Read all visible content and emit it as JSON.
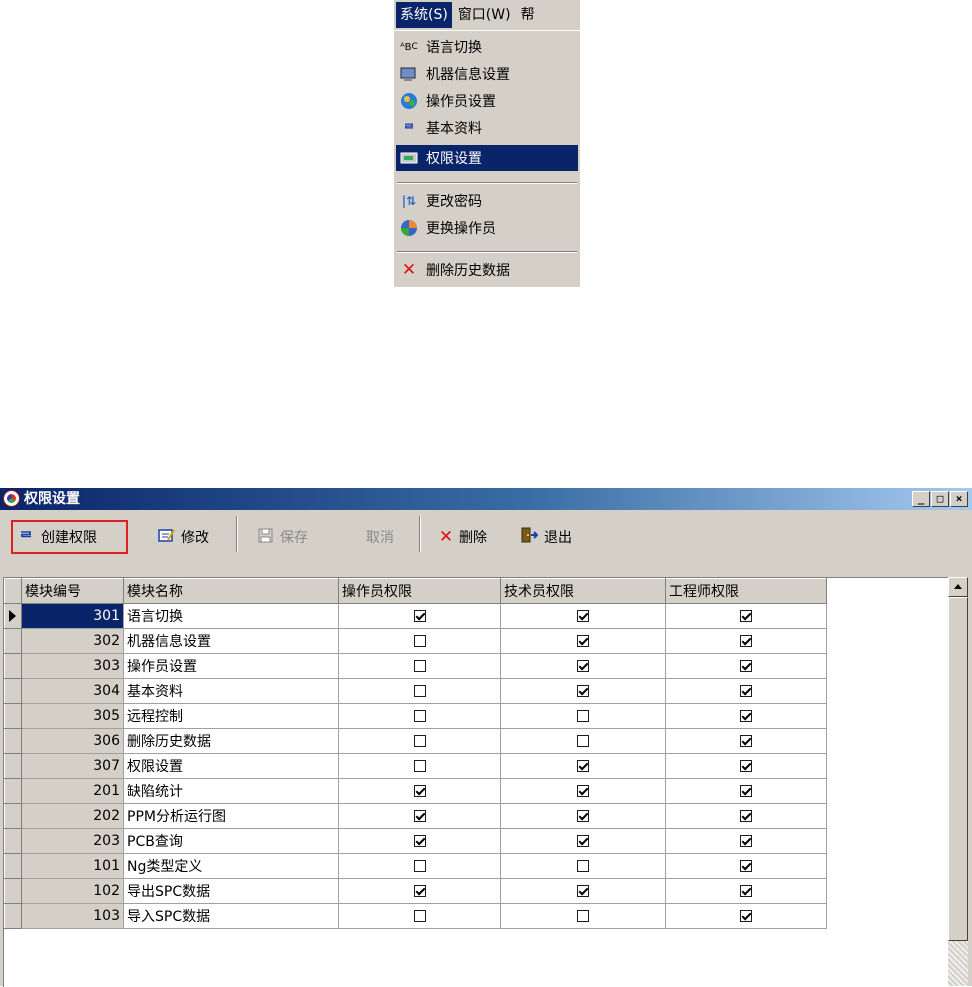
{
  "menubar": {
    "items": [
      {
        "label": "系统(S)"
      },
      {
        "label": "窗口(W)"
      },
      {
        "label": "帮"
      }
    ]
  },
  "dropdown": {
    "items": [
      {
        "label": "语言切换",
        "icon": "language-abc-icon"
      },
      {
        "label": "机器信息设置",
        "icon": "machine-info-icon"
      },
      {
        "label": "操作员设置",
        "icon": "operator-icon"
      },
      {
        "label": "基本资料",
        "icon": "basic-data-icon"
      },
      {
        "label": "权限设置",
        "icon": "permission-icon",
        "selected": true
      },
      {
        "label": "更改密码",
        "icon": "change-password-icon"
      },
      {
        "label": "更换操作员",
        "icon": "switch-operator-icon"
      },
      {
        "label": "删除历史数据",
        "icon": "delete-x-icon"
      }
    ]
  },
  "window": {
    "title": "权限设置",
    "controls": {
      "minimize": "_",
      "maximize": "□",
      "close": "×"
    }
  },
  "toolbar": {
    "create": "创建权限",
    "modify": "修改",
    "save": "保存",
    "cancel": "取消",
    "delete": "删除",
    "exit": "退出"
  },
  "grid": {
    "columns": [
      "模块编号",
      "模块名称",
      "操作员权限",
      "技术员权限",
      "工程师权限"
    ],
    "rows": [
      {
        "id": "301",
        "name": "语言切换",
        "operator": true,
        "technician": true,
        "engineer": true
      },
      {
        "id": "302",
        "name": "机器信息设置",
        "operator": false,
        "technician": true,
        "engineer": true
      },
      {
        "id": "303",
        "name": "操作员设置",
        "operator": false,
        "technician": true,
        "engineer": true
      },
      {
        "id": "304",
        "name": "基本资料",
        "operator": false,
        "technician": true,
        "engineer": true
      },
      {
        "id": "305",
        "name": "远程控制",
        "operator": false,
        "technician": false,
        "engineer": true
      },
      {
        "id": "306",
        "name": "删除历史数据",
        "operator": false,
        "technician": false,
        "engineer": true
      },
      {
        "id": "307",
        "name": "权限设置",
        "operator": false,
        "technician": true,
        "engineer": true
      },
      {
        "id": "201",
        "name": "缺陷统计",
        "operator": true,
        "technician": true,
        "engineer": true
      },
      {
        "id": "202",
        "name": "PPM分析运行图",
        "operator": true,
        "technician": true,
        "engineer": true
      },
      {
        "id": "203",
        "name": "PCB查询",
        "operator": true,
        "technician": true,
        "engineer": true
      },
      {
        "id": "101",
        "name": "Ng类型定义",
        "operator": false,
        "technician": false,
        "engineer": true
      },
      {
        "id": "102",
        "name": "导出SPC数据",
        "operator": true,
        "technician": true,
        "engineer": true
      },
      {
        "id": "103",
        "name": "导入SPC数据",
        "operator": false,
        "technician": false,
        "engineer": true
      }
    ]
  }
}
